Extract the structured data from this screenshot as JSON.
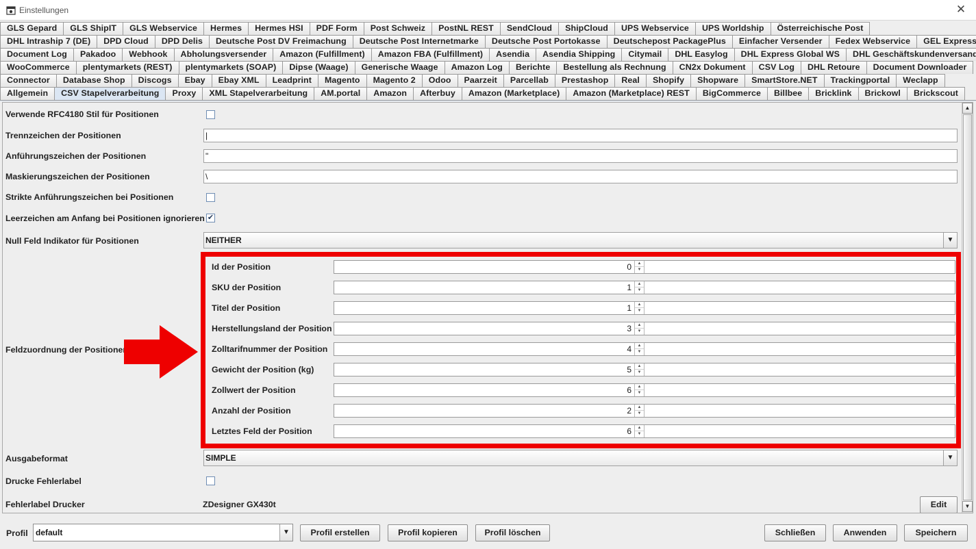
{
  "window": {
    "title": "Einstellungen",
    "close_glyph": "✕"
  },
  "tabs": {
    "rows": [
      [
        "GLS Gepard",
        "GLS ShipIT",
        "GLS Webservice",
        "Hermes",
        "Hermes HSI",
        "PDF Form",
        "Post Schweiz",
        "PostNL REST",
        "SendCloud",
        "ShipCloud",
        "UPS Webservice",
        "UPS Worldship",
        "Österreichische Post"
      ],
      [
        "DHL Intraship 7 (DE)",
        "DPD Cloud",
        "DPD Delis",
        "Deutsche Post DV Freimachung",
        "Deutsche Post Internetmarke",
        "Deutsche Post Portokasse",
        "Deutschepost PackagePlus",
        "Einfacher Versender",
        "Fedex Webservice",
        "GEL Express"
      ],
      [
        "Document Log",
        "Pakadoo",
        "Webhook",
        "Abholungsversender",
        "Amazon (Fulfillment)",
        "Amazon FBA (Fulfillment)",
        "Asendia",
        "Asendia Shipping",
        "Citymail",
        "DHL Easylog",
        "DHL Express Global WS",
        "DHL Geschäftskundenversand"
      ],
      [
        "WooCommerce",
        "plentymarkets (REST)",
        "plentymarkets (SOAP)",
        "Dipse (Waage)",
        "Generische Waage",
        "Amazon Log",
        "Berichte",
        "Bestellung als Rechnung",
        "CN2x Dokument",
        "CSV Log",
        "DHL Retoure",
        "Document Downloader"
      ],
      [
        "Connector",
        "Database Shop",
        "Discogs",
        "Ebay",
        "Ebay XML",
        "Leadprint",
        "Magento",
        "Magento 2",
        "Odoo",
        "Paarzeit",
        "Parcellab",
        "Prestashop",
        "Real",
        "Shopify",
        "Shopware",
        "SmartStore.NET",
        "Trackingportal",
        "Weclapp"
      ],
      [
        "Allgemein",
        "CSV Stapelverarbeitung",
        "Proxy",
        "XML Stapelverarbeitung",
        "AM.portal",
        "Amazon",
        "Afterbuy",
        "Amazon (Marketplace)",
        "Amazon (Marketplace) REST",
        "BigCommerce",
        "Billbee",
        "Bricklink",
        "Brickowl",
        "Brickscout"
      ]
    ],
    "active": "CSV Stapelverarbeitung"
  },
  "form": {
    "rfc4180_label": "Verwende RFC4180 Stil für Positionen",
    "rfc4180_checked": false,
    "separator_label": "Trennzeichen der Positionen",
    "separator_value": "|",
    "quote_label": "Anführungszeichen der Positionen",
    "quote_value": "\"",
    "escape_label": "Maskierungszeichen der Positionen",
    "escape_value": "\\",
    "strict_quotes_label": "Strikte Anführungszeichen bei Positionen",
    "strict_quotes_checked": false,
    "ignore_leading_ws_label": "Leerzeichen am Anfang bei Positionen ignorieren",
    "ignore_leading_ws_checked": true,
    "null_field_label": "Null Feld Indikator für Positionen",
    "null_field_value": "NEITHER",
    "field_mapping_label": "Feldzuordnung der Positionen",
    "field_mapping": [
      {
        "label": "Id der Position",
        "value": "0"
      },
      {
        "label": "SKU der Position",
        "value": "1"
      },
      {
        "label": "Titel der Position",
        "value": "1"
      },
      {
        "label": "Herstellungsland der Position",
        "value": "3"
      },
      {
        "label": "Zolltarifnummer der Position",
        "value": "4"
      },
      {
        "label": "Gewicht der Position (kg)",
        "value": "5"
      },
      {
        "label": "Zollwert der Position",
        "value": "6"
      },
      {
        "label": "Anzahl der Position",
        "value": "2"
      },
      {
        "label": "Letztes Feld der Position",
        "value": "6"
      }
    ],
    "output_format_label": "Ausgabeformat",
    "output_format_value": "SIMPLE",
    "print_error_label": "Drucke Fehlerlabel",
    "print_error_checked": false,
    "error_printer_label": "Fehlerlabel Drucker",
    "error_printer_value": "ZDesigner GX430t",
    "edit_button": "Edit"
  },
  "bottom": {
    "profile_label": "Profil",
    "profile_value": "default",
    "create_profile": "Profil erstellen",
    "copy_profile": "Profil kopieren",
    "delete_profile": "Profil löschen",
    "close": "Schließen",
    "apply": "Anwenden",
    "save": "Speichern"
  },
  "colors": {
    "highlight": "#ee0000",
    "active_tab": "#dbe6f3",
    "checkbox_border": "#6f8db3"
  },
  "icons": {
    "check": "✔",
    "arrow_down": "▼",
    "arrow_up": "▲"
  }
}
